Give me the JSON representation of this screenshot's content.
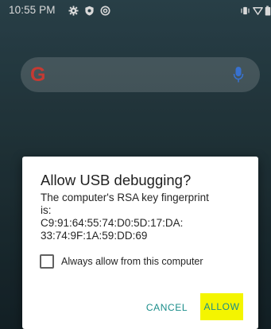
{
  "status_bar": {
    "time": "10:55 PM",
    "left_icons": [
      "gear-icon",
      "shield-icon",
      "sync-icon"
    ],
    "right_icons": [
      "vibrate-icon",
      "wifi-icon",
      "battery-icon"
    ]
  },
  "search_widget": {
    "logo_letter": "G",
    "mic_icon": "mic-icon"
  },
  "dialog": {
    "title": "Allow USB debugging?",
    "message_lines": [
      "The computer's RSA key fingerprint",
      "is:",
      "C9:91:64:55:74:D0:5D:17:DA:",
      "33:74:9F:1A:59:DD:69"
    ],
    "checkbox": {
      "label": "Always allow from this computer",
      "checked": false
    },
    "buttons": {
      "cancel": "CANCEL",
      "allow": "ALLOW"
    },
    "accent_color": "#1a8d8a",
    "highlight_color": "#f4f500"
  }
}
